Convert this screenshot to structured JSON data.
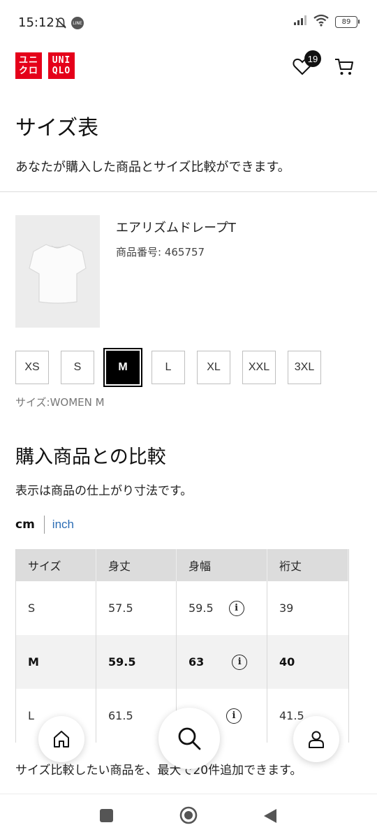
{
  "status_bar": {
    "time": "15:12",
    "battery": "89",
    "icons": [
      "bell-off-icon",
      "line-app-icon",
      "signal-icon",
      "wifi-icon",
      "battery-icon"
    ]
  },
  "header": {
    "logo_left": [
      "ユニ",
      "クロ"
    ],
    "logo_right": [
      "UNI",
      "QLO"
    ],
    "wishlist_count": "19",
    "brand_color": "#e5001a"
  },
  "page": {
    "title": "サイズ表",
    "subtitle": "あなたが購入した商品とサイズ比較ができます。"
  },
  "product": {
    "name": "エアリズムドレープT",
    "number_label": "商品番号: 465757",
    "sizes": [
      "XS",
      "S",
      "M",
      "L",
      "XL",
      "XXL",
      "3XL"
    ],
    "selected_size": "M",
    "size_info": "サイズ:WOMEN M"
  },
  "comparison": {
    "title": "購入商品との比較",
    "note": "表示は商品の仕上がり寸法です。",
    "unit_cm": "cm",
    "unit_inch": "inch",
    "active_unit": "cm",
    "link_color": "#2b6db5"
  },
  "table": {
    "headers": [
      "サイズ",
      "身丈",
      "身幅",
      "裄丈"
    ],
    "rows": [
      {
        "size": "S",
        "length": "57.5",
        "width": "59.5",
        "sleeve": "39"
      },
      {
        "size": "M",
        "length": "59.5",
        "width": "63",
        "sleeve": "40"
      },
      {
        "size": "L",
        "length": "61.5",
        "width": "",
        "sleeve": "41.5"
      }
    ],
    "info_glyph": "i"
  },
  "footer_text": "サイズ比較したい商品を、最大で20件追加できます。",
  "floating_nav": [
    "home-icon",
    "search-icon",
    "user-icon"
  ],
  "system_nav": [
    "recents-button",
    "home-button",
    "back-button"
  ]
}
